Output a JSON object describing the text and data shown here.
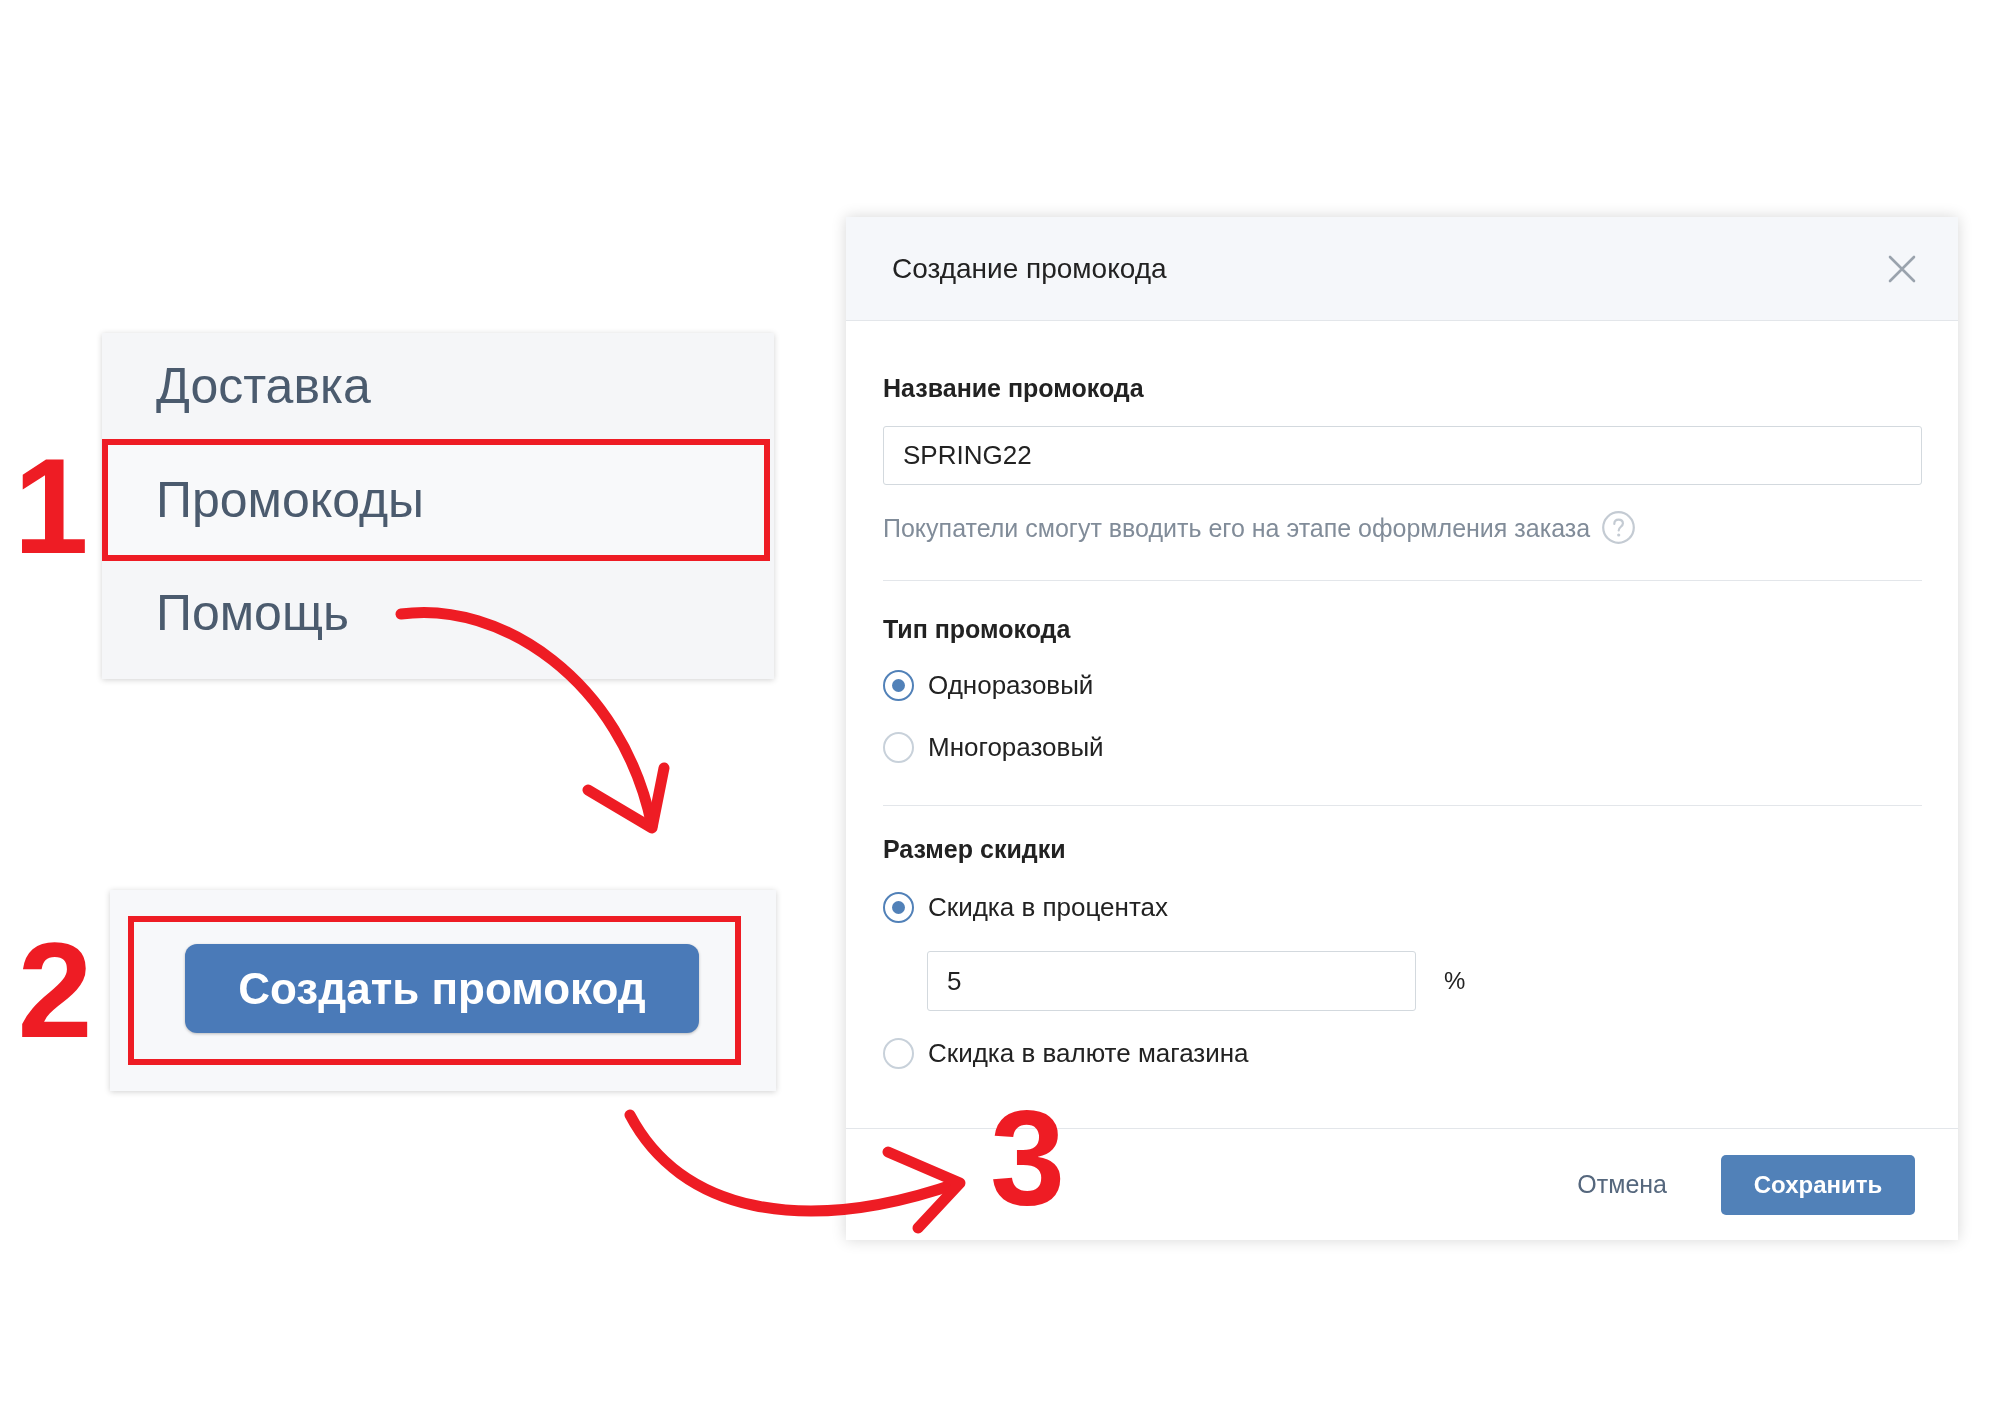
{
  "menu": {
    "step_label": "1",
    "items": [
      {
        "label": "Доставка",
        "highlighted": false
      },
      {
        "label": "Промокоды",
        "highlighted": true
      },
      {
        "label": "Помощь",
        "highlighted": false
      }
    ]
  },
  "create_panel": {
    "step_label": "2",
    "highlighted": true,
    "button": "Создать промокод"
  },
  "dialog": {
    "step_label": "3",
    "title": "Создание промокода",
    "name_field": {
      "label": "Название промокода",
      "value": "SPRING22",
      "hint": "Покупатели смогут вводить его на этапе оформления заказа"
    },
    "type": {
      "label": "Тип промокода",
      "options": [
        {
          "label": "Одноразовый",
          "selected": true
        },
        {
          "label": "Многоразовый",
          "selected": false
        }
      ]
    },
    "discount": {
      "label": "Размер скидки",
      "options": [
        {
          "label": "Скидка в процентах",
          "selected": true,
          "input": {
            "value": "5",
            "unit": "%"
          }
        },
        {
          "label": "Скидка в валюте магазина",
          "selected": false
        }
      ]
    },
    "buttons": [
      {
        "label": "Отмена",
        "kind": "secondary"
      },
      {
        "label": "Сохранить",
        "kind": "primary"
      }
    ]
  }
}
